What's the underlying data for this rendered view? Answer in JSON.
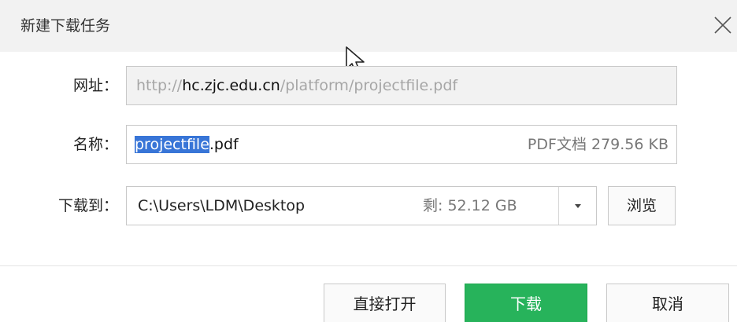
{
  "dialog": {
    "title": "新建下载任务",
    "close_icon": "close-icon"
  },
  "url_row": {
    "label": "网址：",
    "scheme": "http://",
    "host": "hc.zjc.edu.cn",
    "path": "/platform/projectfile.pdf"
  },
  "name_row": {
    "label": "名称：",
    "selected_part": "projectfile",
    "extension": ".pdf",
    "file_info": "PDF文档 279.56 KB"
  },
  "save_row": {
    "label": "下载到：",
    "path": "C:\\Users\\LDM\\Desktop",
    "free_space": "剩: 52.12 GB",
    "dropdown_icon": "caret-down-icon",
    "browse_label": "浏览"
  },
  "buttons": {
    "open_directly": "直接打开",
    "download": "下载",
    "cancel": "取消"
  },
  "colors": {
    "accent_green": "#27b35b",
    "selection_blue": "#3875d7",
    "title_bar": "#f2f2f2"
  }
}
